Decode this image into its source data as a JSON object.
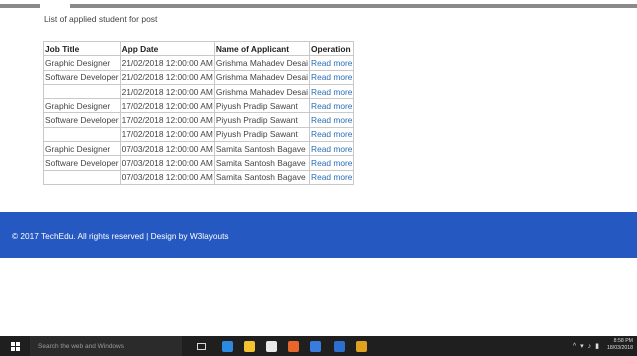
{
  "page": {
    "heading": "List of applied student for post"
  },
  "table": {
    "headers": [
      "Job Title",
      "App Date",
      "Name of Applicant",
      "Operation"
    ],
    "rows": [
      {
        "job_title": "Graphic Designer",
        "app_date": "21/02/2018 12:00:00 AM",
        "applicant": "Grishma Mahadev Desai",
        "operation": "Read more"
      },
      {
        "job_title": "Software Developer",
        "app_date": "21/02/2018 12:00:00 AM",
        "applicant": "Grishma Mahadev Desai",
        "operation": "Read more"
      },
      {
        "job_title": "",
        "app_date": "21/02/2018 12:00:00 AM",
        "applicant": "Grishma Mahadev Desai",
        "operation": "Read more"
      },
      {
        "job_title": "Graphic Designer",
        "app_date": "17/02/2018 12:00:00 AM",
        "applicant": "Piyush Pradip Sawant",
        "operation": "Read more"
      },
      {
        "job_title": "Software Developer",
        "app_date": "17/02/2018 12:00:00 AM",
        "applicant": "Piyush Pradip Sawant",
        "operation": "Read more"
      },
      {
        "job_title": "",
        "app_date": "17/02/2018 12:00:00 AM",
        "applicant": "Piyush Pradip Sawant",
        "operation": "Read more"
      },
      {
        "job_title": "Graphic Designer",
        "app_date": "07/03/2018 12:00:00 AM",
        "applicant": "Samita Santosh Bagave",
        "operation": "Read more"
      },
      {
        "job_title": "Software Developer",
        "app_date": "07/03/2018 12:00:00 AM",
        "applicant": "Samita Santosh Bagave",
        "operation": "Read more"
      },
      {
        "job_title": "",
        "app_date": "07/03/2018 12:00:00 AM",
        "applicant": "Samita Santosh Bagave",
        "operation": "Read more"
      }
    ]
  },
  "footer": {
    "text": "© 2017 TechEdu. All rights reserved | Design by W3layouts",
    "background": "#2558c0"
  },
  "taskbar": {
    "search_placeholder": "Search the web and Windows",
    "apps": [
      {
        "icon": "edge-icon",
        "color": "#2b8ae0"
      },
      {
        "icon": "file-explorer-icon",
        "color": "#f2c230"
      },
      {
        "icon": "store-icon",
        "color": "#e8e8e8"
      },
      {
        "icon": "firefox-icon",
        "color": "#e8662a"
      },
      {
        "icon": "media-icon",
        "color": "#3a7be0"
      },
      {
        "icon": "app-icon",
        "color": "#2d6fd0"
      },
      {
        "icon": "chrome-icon",
        "color": "#e0a020"
      }
    ],
    "time": "8:58 PM",
    "date": "18/03/2018"
  }
}
